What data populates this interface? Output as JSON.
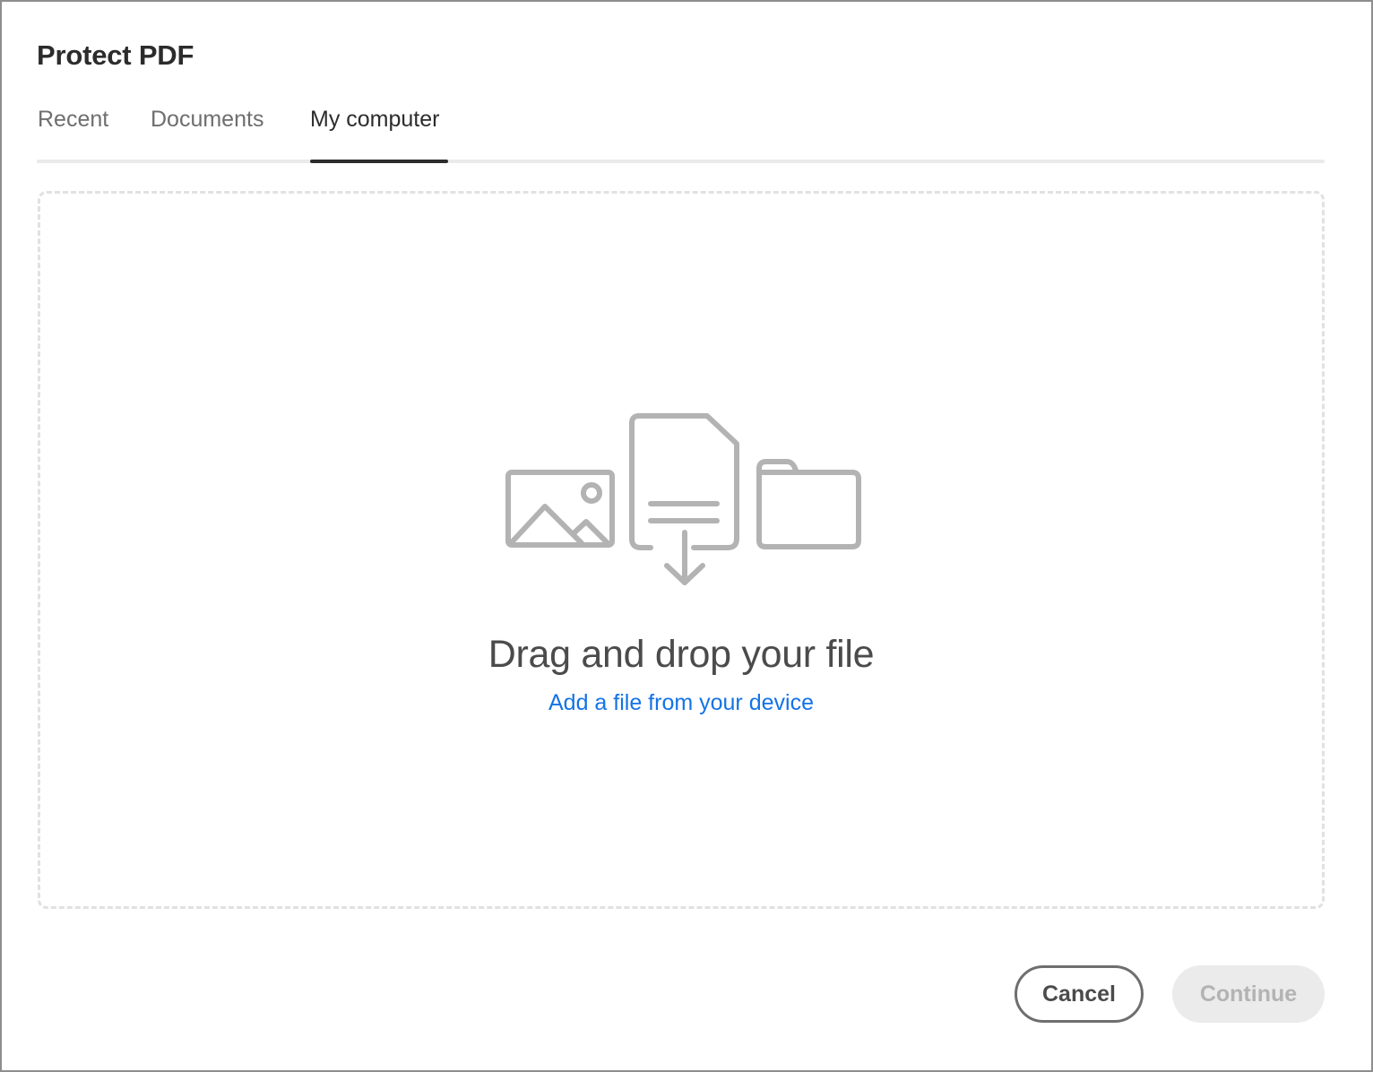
{
  "dialog": {
    "title": "Protect PDF"
  },
  "tabs": [
    {
      "label": "Recent",
      "selected": false
    },
    {
      "label": "Documents",
      "selected": false
    },
    {
      "label": "My computer",
      "selected": true
    }
  ],
  "dropzone": {
    "icons": [
      "image-icon",
      "document-download-icon",
      "folder-icon"
    ],
    "title": "Drag and drop your file",
    "link": "Add a file from your device"
  },
  "footer": {
    "cancel_label": "Cancel",
    "continue_label": "Continue",
    "continue_disabled": true
  },
  "colors": {
    "link": "#1473e6",
    "text": "#2c2c2c",
    "icon": "#b3b3b3",
    "disabled_bg": "#ebebeb",
    "disabled_text": "#b3b3b3"
  }
}
